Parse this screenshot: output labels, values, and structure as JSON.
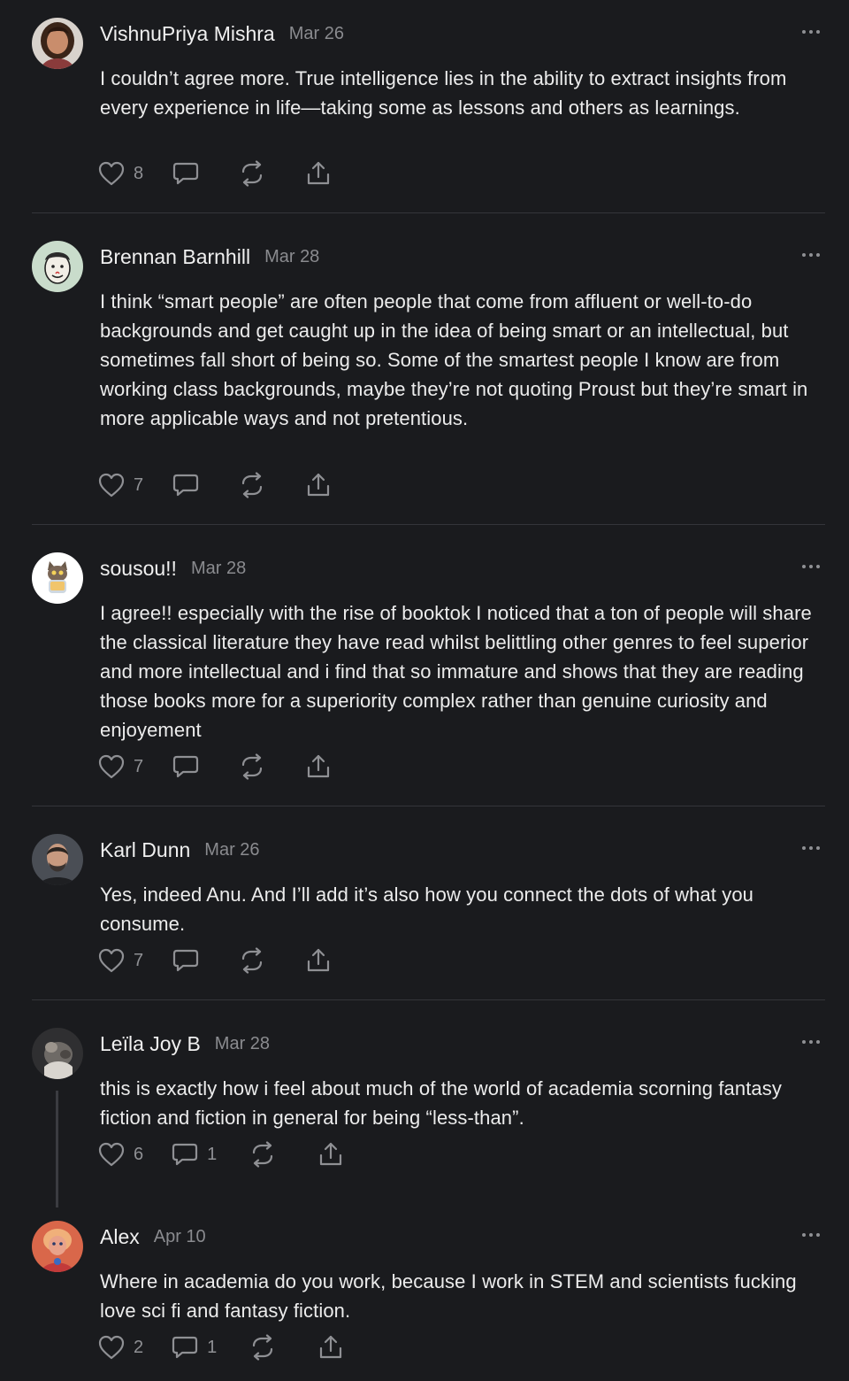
{
  "comments": [
    {
      "author": "VishnuPriya Mishra",
      "date": "Mar 26",
      "text": "I couldn’t agree more. True intelligence lies in the ability to extract insights from every experience in life—taking some as lessons and others as learnings.",
      "likes": "8",
      "replies": ""
    },
    {
      "author": "Brennan Barnhill",
      "date": "Mar 28",
      "text": "I think “smart people” are often people that come from affluent or well-to-do backgrounds and get caught up in the idea of being smart or an intellectual, but sometimes fall short of being so. Some of the smartest people I know are from working class backgrounds, maybe they’re not quoting Proust but they’re smart in more applicable ways and not pretentious.",
      "likes": "7",
      "replies": ""
    },
    {
      "author": "sousou!!",
      "date": "Mar 28",
      "text": "I agree!! especially with the rise of booktok I noticed that a ton of people will share the classical literature they have read whilst belittling other genres to feel superior and more intellectual and i find that so immature and shows that they are reading those books more for a superiority complex rather than genuine curiosity and enjoyement",
      "likes": "7",
      "replies": ""
    },
    {
      "author": "Karl Dunn",
      "date": "Mar 26",
      "text": "Yes, indeed Anu. And I’ll add it’s also how you connect the dots of what you consume.",
      "likes": "7",
      "replies": ""
    },
    {
      "author": "Leïla Joy B",
      "date": "Mar 28",
      "text": "this is exactly how i feel about much of the world of academia scorning fantasy fiction and fiction in general for being “less-than”.",
      "likes": "6",
      "replies": "1"
    },
    {
      "author": "Alex",
      "date": "Apr 10",
      "text": "Where in academia do you work, because I work in STEM and scientists fucking love sci fi and fantasy fiction.",
      "likes": "2",
      "replies": "1"
    }
  ],
  "icons": {
    "like": "heart-icon",
    "reply": "speech-bubble-icon",
    "restack": "restack-arrows-icon",
    "share": "share-upload-icon",
    "more": "more-dots-icon"
  },
  "colors": {
    "background": "#1a1b1e",
    "text": "#ececec",
    "muted": "#8f9094",
    "divider": "#34353a"
  }
}
